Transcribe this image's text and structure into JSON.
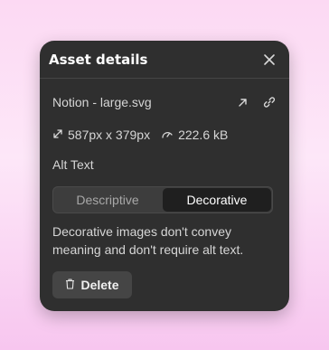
{
  "panel": {
    "title": "Asset details",
    "close_icon": "close-icon"
  },
  "file": {
    "name": "Notion - large.svg",
    "open_icon": "external-link-icon",
    "link_icon": "link-icon"
  },
  "meta": {
    "dimensions": "587px x 379px",
    "size": "222.6 kB",
    "dimensions_icon": "resize-icon",
    "size_icon": "gauge-icon"
  },
  "alt_text": {
    "label": "Alt Text",
    "options": [
      "Descriptive",
      "Decorative"
    ],
    "selected": "Decorative",
    "description": "Decorative images don't convey meaning and don't require alt text."
  },
  "actions": {
    "delete_label": "Delete",
    "delete_icon": "trash-icon"
  },
  "colors": {
    "panel_bg": "#2f2f2f",
    "active_segment_bg": "#1f1f1f",
    "background_pink": "#fcd9f3"
  }
}
